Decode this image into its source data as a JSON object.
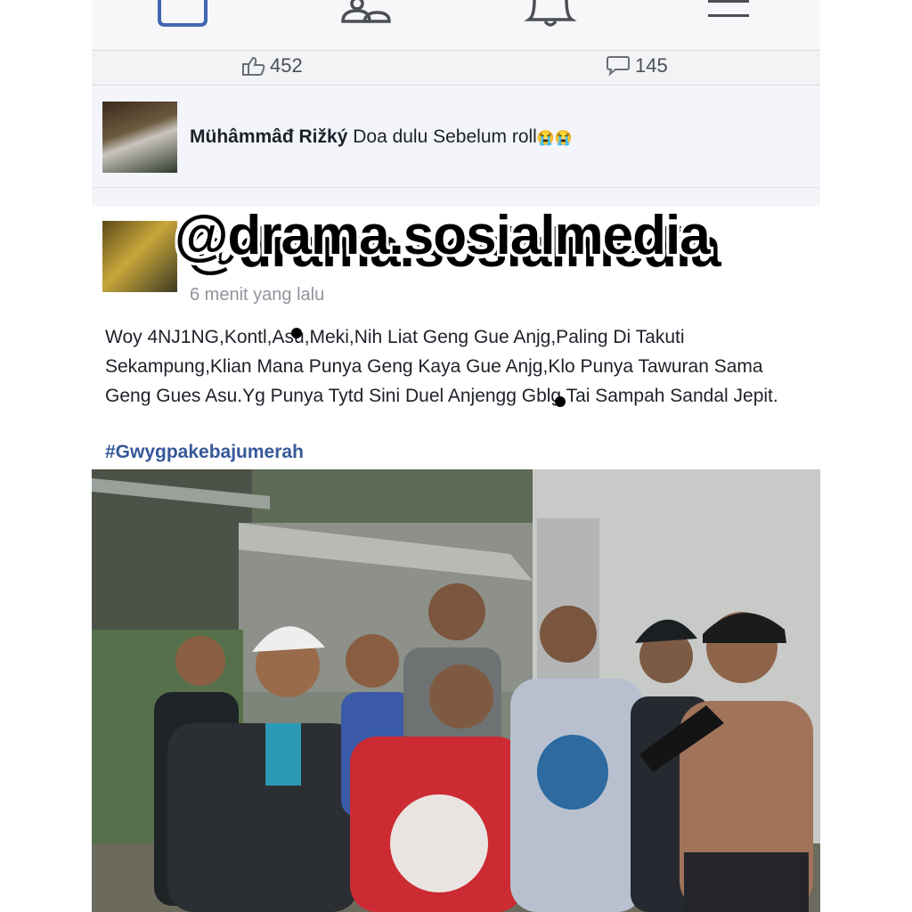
{
  "reactions": {
    "likes_count": "452",
    "comments_count": "145"
  },
  "comment": {
    "author": "Mühâmmâđ Rižký",
    "text": "Doa dulu Sebelum roll",
    "emoji": "😭😭"
  },
  "post": {
    "time": "6 menit yang lalu",
    "body": "Woy 4NJ1NG,Kontl,Asu,Meki,Nih Liat Geng Gue Anjg,Paling Di Takuti Sekampung,Klian Mana Punya Geng Kaya Gue Anjg,Klo Punya Tawuran Sama Geng Gues Asu.Yg Punya Tytd Sini Duel Anjengg Gblg Tai Sampah Sandal Jepit.",
    "hashtag": "#Gwygpakebajumerah"
  },
  "watermark": "@drama.sosialmedia",
  "icons": {
    "nav": [
      "newsfeed-icon",
      "friends-icon",
      "notifications-bell-icon",
      "menu-icon"
    ],
    "reactions": [
      "like-icon",
      "comment-icon"
    ]
  },
  "colors": {
    "hashtag": "#365899",
    "nav_active": "#4267b2",
    "nav_inactive": "#4b4f56"
  }
}
